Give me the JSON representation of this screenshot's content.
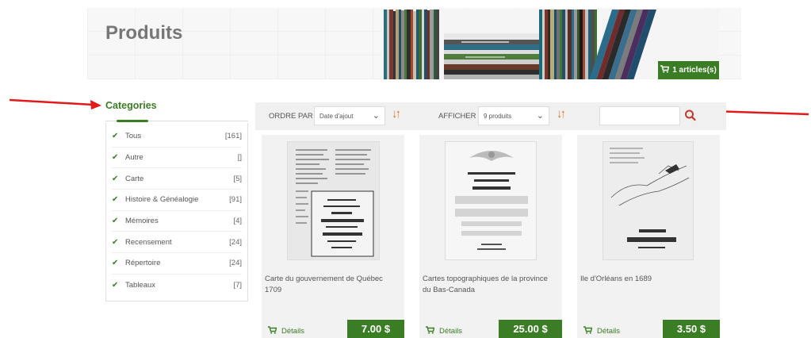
{
  "header": {
    "title": "Produits",
    "cart_label": "1 articles(s)",
    "cart_icon": "cart-icon"
  },
  "sidebar": {
    "title": "Categories",
    "items": [
      {
        "label": "Tous",
        "count": "[161]"
      },
      {
        "label": "Autre",
        "count": "[]"
      },
      {
        "label": "Carte",
        "count": "[5]"
      },
      {
        "label": "Histoire & Généalogie",
        "count": "[91]"
      },
      {
        "label": "Mémoires",
        "count": "[4]"
      },
      {
        "label": "Recensement",
        "count": "[24]"
      },
      {
        "label": "Répertoire",
        "count": "[24]"
      },
      {
        "label": "Tableaux",
        "count": "[7]"
      }
    ]
  },
  "toolbar": {
    "order_label": "ORDRE PAR :",
    "order_value": "Date d'ajout",
    "show_label": "AFFICHER :",
    "show_value": "9 produits",
    "search_value": ""
  },
  "products": [
    {
      "name": "Carte du gouvernement de Québec 1709",
      "details_label": "Détails",
      "price": "7.00 $"
    },
    {
      "name": "Cartes topographiques de la province du Bas-Canada",
      "details_label": "Détails",
      "price": "25.00 $"
    },
    {
      "name": "Ile d'Orléans en 1689",
      "details_label": "Détails",
      "price": "3.50 $"
    }
  ],
  "colors": {
    "accent": "#3a7d25",
    "sort_icon": "#e8762c",
    "search_icon": "#c0392b",
    "arrow": "#e01b1b"
  }
}
